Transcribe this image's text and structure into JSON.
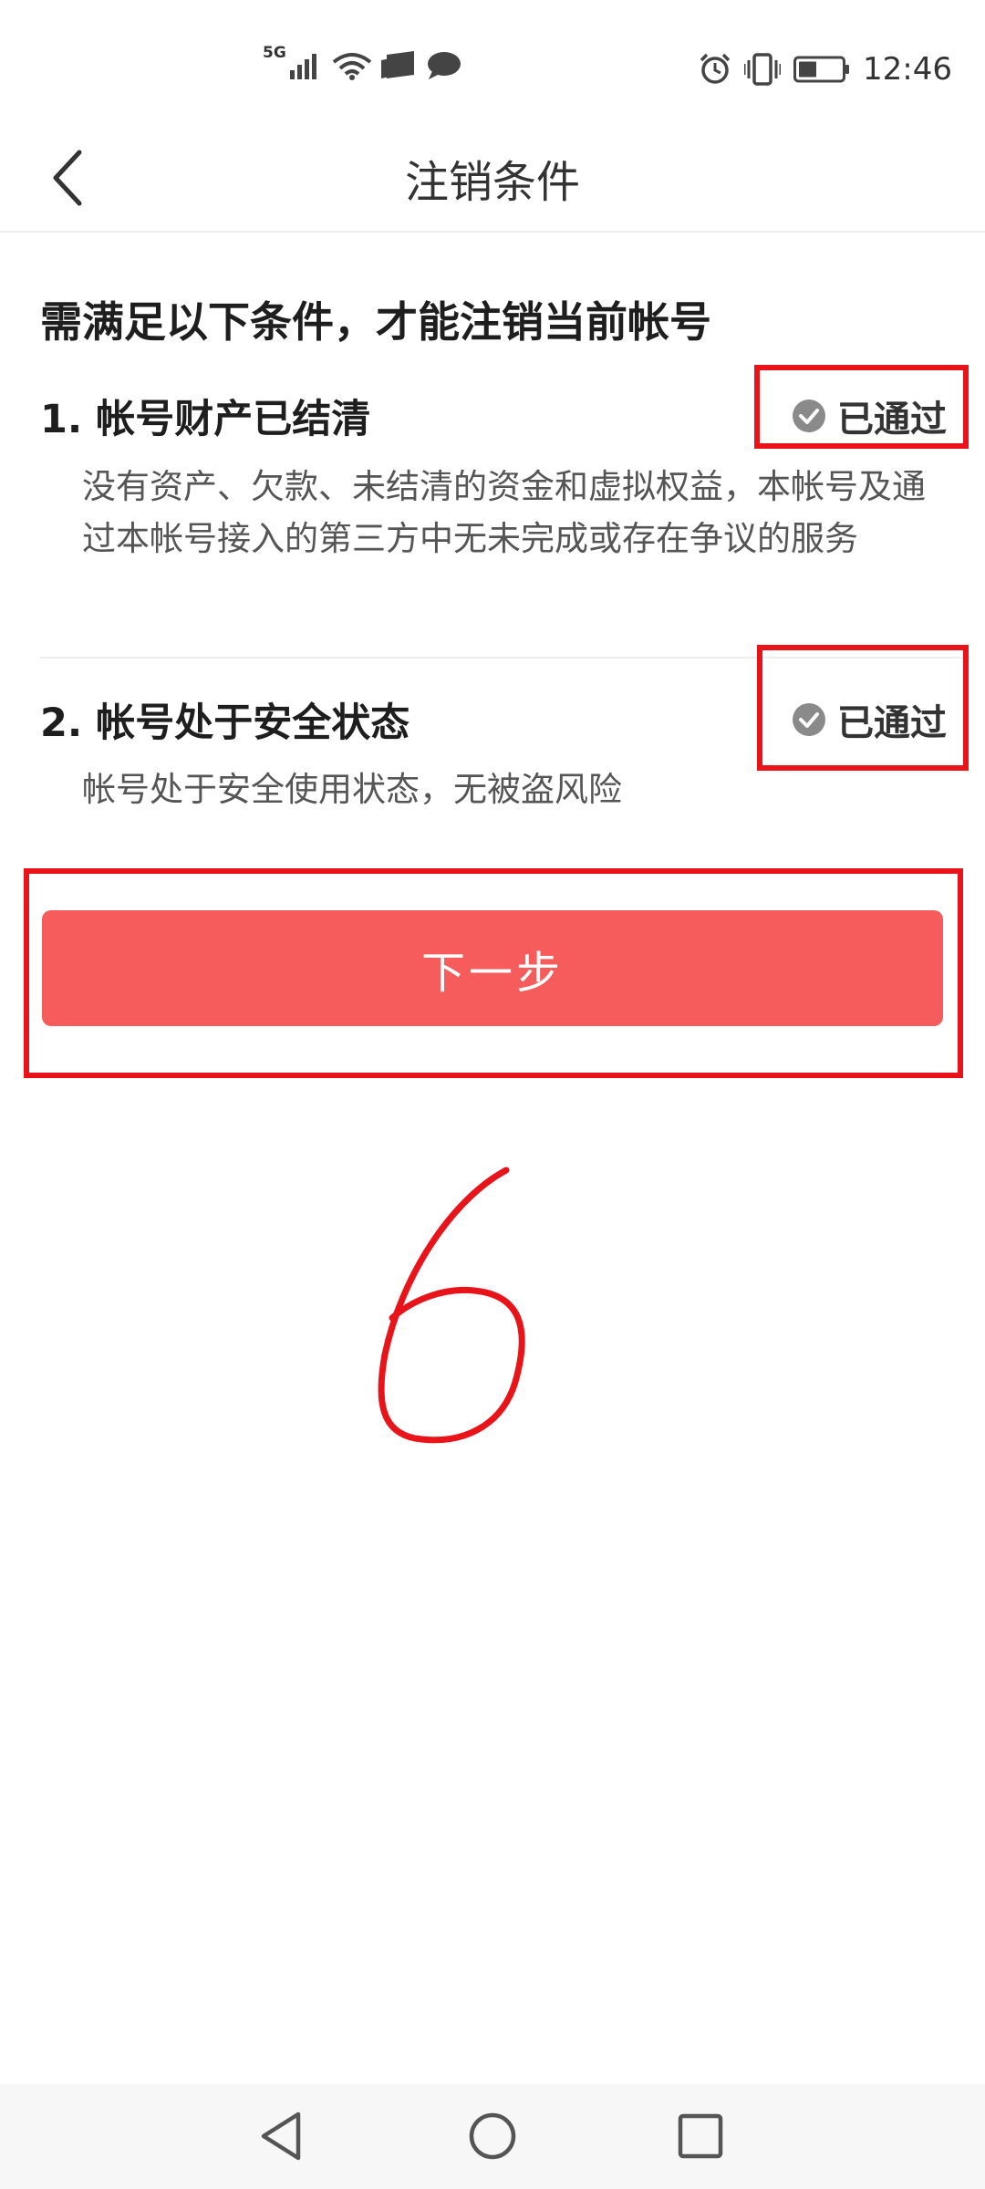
{
  "status_bar": {
    "network": "5G",
    "time": "12:46",
    "left_icons": [
      "signal-icon",
      "wifi-icon",
      "cast-icon",
      "message-icon"
    ],
    "right_icons": [
      "alarm-icon",
      "vibrate-icon",
      "battery-icon"
    ],
    "battery_level": 0.4
  },
  "header": {
    "title": "注销条件",
    "back_icon": "chevron-left-icon"
  },
  "intro": "需满足以下条件，才能注销当前帐号",
  "conditions": [
    {
      "title": "1. 帐号财产已结清",
      "status": "已通过",
      "description": "没有资产、欠款、未结清的资金和虚拟权益，本帐号及通过本帐号接入的第三方中无未完成或存在争议的服务"
    },
    {
      "title": "2. 帐号处于安全状态",
      "status": "已通过",
      "description": "帐号处于安全使用状态，无被盗风险"
    }
  ],
  "next_button": "下一步",
  "annotation_text": "6",
  "nav": {
    "back_icon": "triangle-back-icon",
    "home_icon": "circle-home-icon",
    "recent_icon": "square-recent-icon"
  },
  "colors": {
    "primary_button": "#f65c5c",
    "annotation_red": "#e8141a",
    "status_check": "#8a8a8a"
  }
}
